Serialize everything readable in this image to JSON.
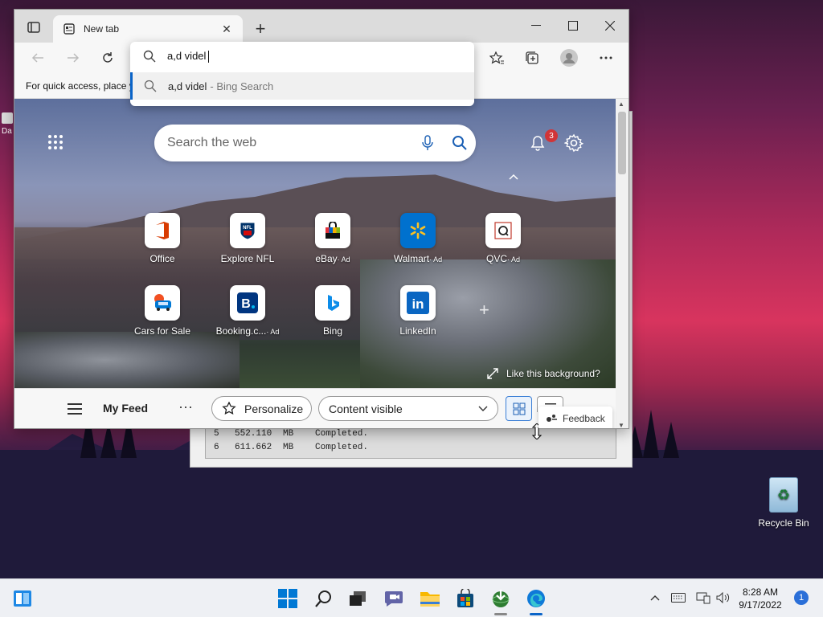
{
  "desktop": {
    "left_label": "Da",
    "recycle_bin_label": "Recycle Bin"
  },
  "background_window": {
    "rows": [
      {
        "n": "5",
        "size": "552.110",
        "unit": "MB",
        "status": "Completed."
      },
      {
        "n": "6",
        "size": "611.662",
        "unit": "MB",
        "status": "Completed."
      }
    ]
  },
  "browser": {
    "tab_title": "New tab",
    "favorites_bar_text": "For quick access, place y",
    "omnibox": {
      "value": "a,d videl",
      "suggestion_text": "a,d videl",
      "suggestion_sub": "- Bing Search"
    },
    "page": {
      "search_placeholder": "Search the web",
      "notification_count": "3",
      "tiles": [
        {
          "label": "Office",
          "ad": ""
        },
        {
          "label": "Explore NFL",
          "ad": ""
        },
        {
          "label": "eBay",
          "ad": "· Ad"
        },
        {
          "label": "Walmart",
          "ad": "· Ad"
        },
        {
          "label": "QVC",
          "ad": "· Ad"
        },
        {
          "label": "Cars for Sale",
          "ad": ""
        },
        {
          "label": "Booking.c...",
          "ad": "· Ad"
        },
        {
          "label": "Bing",
          "ad": ""
        },
        {
          "label": "LinkedIn",
          "ad": ""
        }
      ],
      "like_background": "Like this background?"
    },
    "feed": {
      "title": "My Feed",
      "more": "···",
      "personalize": "Personalize",
      "content_select": "Content visible",
      "feedback": "Feedback"
    }
  },
  "taskbar": {
    "time": "8:28 AM",
    "date": "9/17/2022",
    "notification_count": "1"
  },
  "colors": {
    "accent": "#0a64c8",
    "badge_red": "#d13438"
  }
}
